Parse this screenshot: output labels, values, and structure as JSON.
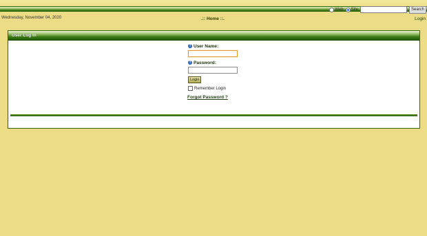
{
  "header": {
    "search": {
      "web_label": "Web",
      "site_label": "Site",
      "selected": "Site",
      "input_value": "",
      "button_label": "Search"
    },
    "date": "Wednesday, November 04, 2020",
    "home_link": ".:: Home ::.",
    "login_link": "Login"
  },
  "panel": {
    "title": "User Log In",
    "username_label": "User Name:",
    "username_value": "",
    "password_label": "Password:",
    "password_value": "",
    "login_button": "Login",
    "remember_label": "Remember Login",
    "remember_checked": false,
    "forgot_link": "Forgot Password ?"
  },
  "colors": {
    "background": "#ecdc86",
    "accent_green": "#2b6a0c",
    "focus_orange": "#e49a2a"
  }
}
